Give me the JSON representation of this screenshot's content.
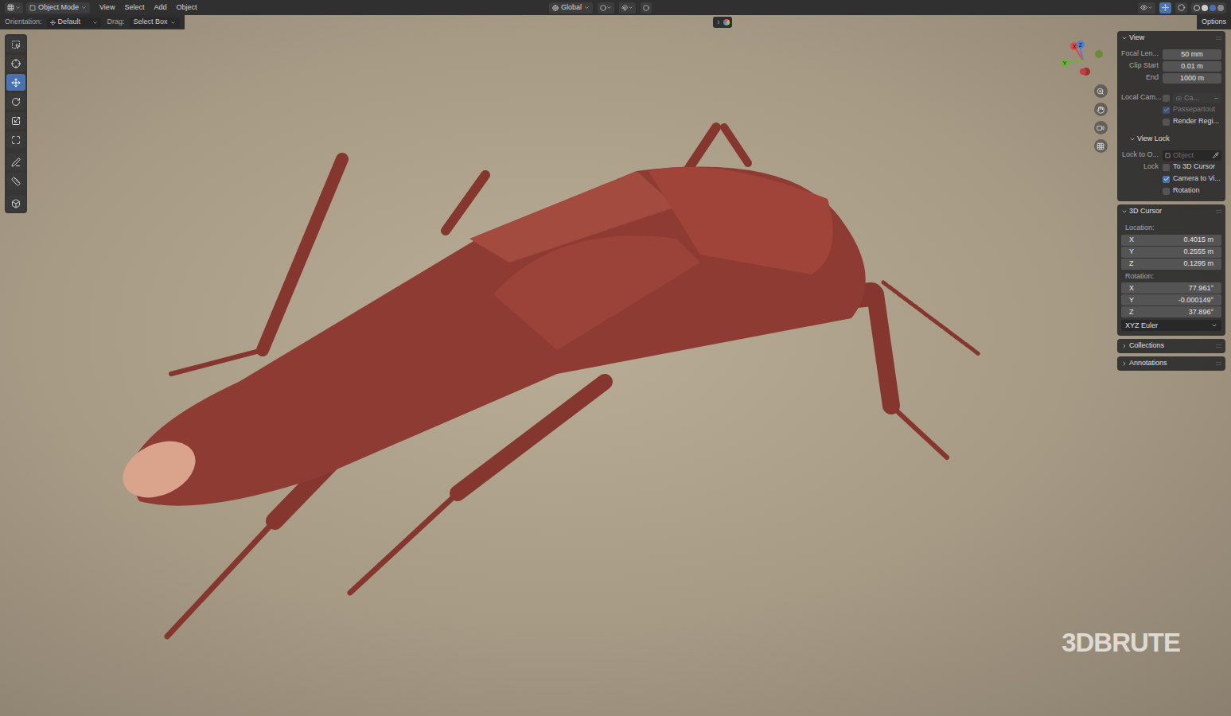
{
  "header": {
    "mode": "Object Mode",
    "menus": [
      "View",
      "Select",
      "Add",
      "Object"
    ],
    "orientation": "Global"
  },
  "tool_settings": {
    "orientation_label": "Orientation:",
    "orientation": "Default",
    "drag_label": "Drag:",
    "drag": "Select Box",
    "options": "Options"
  },
  "toolbar": [
    {
      "kind": "select",
      "selected": false
    },
    {
      "kind": "cursor",
      "selected": false
    },
    {
      "kind": "move",
      "selected": true
    },
    {
      "kind": "rotate",
      "selected": false
    },
    {
      "kind": "scale",
      "selected": false
    },
    {
      "kind": "transform",
      "selected": false
    },
    {
      "kind": "annotate",
      "selected": false
    },
    {
      "kind": "measure",
      "selected": false
    },
    {
      "kind": "add",
      "selected": false
    }
  ],
  "gizmo": {
    "x": "X",
    "y": "Y",
    "z": "Z"
  },
  "sidebar": {
    "sections": [
      {
        "title": "View",
        "expanded": true,
        "rows": [
          {
            "kind": "field",
            "label": "Focal Len...",
            "value": "50 mm"
          },
          {
            "kind": "field",
            "label": "Clip Start",
            "value": "0.01 m"
          },
          {
            "kind": "field",
            "label": "End",
            "value": "1000 m"
          },
          {
            "kind": "camera",
            "label": "Local Cam...",
            "checked": false,
            "value": "Ca..."
          },
          {
            "kind": "check",
            "label": "Passepartout",
            "checked": true,
            "disabled": true
          },
          {
            "kind": "check",
            "label": "Render Regi...",
            "checked": false,
            "disabled": false
          },
          {
            "kind": "subheader",
            "label": "View Lock",
            "expanded": true
          },
          {
            "kind": "object",
            "label": "Lock to O...",
            "value": "Object"
          },
          {
            "kind": "check",
            "side_label": "Lock",
            "label": "To 3D Cursor",
            "checked": false,
            "disabled": false
          },
          {
            "kind": "check",
            "label": "Camera to Vi...",
            "checked": true,
            "disabled": false
          },
          {
            "kind": "check",
            "label": "Rotation",
            "checked": false,
            "disabled": false
          }
        ]
      },
      {
        "title": "3D Cursor",
        "expanded": true,
        "rows": [
          {
            "kind": "heading",
            "label": "Location:"
          },
          {
            "kind": "axis",
            "label": "X",
            "value": "0.4015 m"
          },
          {
            "kind": "axis",
            "label": "Y",
            "value": "0.2555 m"
          },
          {
            "kind": "axis",
            "label": "Z",
            "value": "0.1295 m"
          },
          {
            "kind": "heading",
            "label": "Rotation:"
          },
          {
            "kind": "axis",
            "label": "X",
            "value": "77.961°"
          },
          {
            "kind": "axis",
            "label": "Y",
            "value": "-0.000149°"
          },
          {
            "kind": "axis",
            "label": "Z",
            "value": "37.896°"
          },
          {
            "kind": "select",
            "value": "XYZ Euler"
          }
        ]
      },
      {
        "title": "Collections",
        "expanded": false,
        "rows": []
      },
      {
        "title": "Annotations",
        "expanded": false,
        "rows": []
      }
    ]
  },
  "watermark": "3DBRUTE"
}
